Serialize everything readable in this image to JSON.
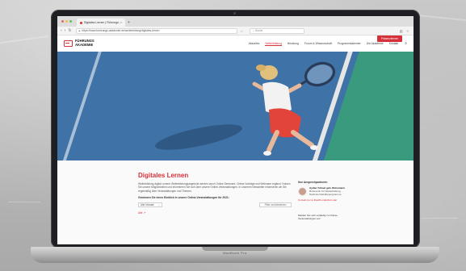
{
  "browser": {
    "tab_title": "Digitales Lernen | Führungs...",
    "tab_close": "×",
    "new_tab": "+",
    "url": "https://www.fuehrungs-akademie.de/weiterbildung/digitales-lernen",
    "search_placeholder": "Suche",
    "nav_back": "‹",
    "nav_forward": "›",
    "nav_reload": "↻"
  },
  "site": {
    "logo_line1": "FÜHRUNGS",
    "logo_line2": "AKADEMIE",
    "nav": [
      "Aktuelles",
      "Weiterbildung",
      "Beratung",
      "Forum & Wissenschaft",
      "Programmkalender",
      "Die Akademie",
      "Kontakt"
    ],
    "active_nav_index": 1,
    "cta": "Präsenzlernen"
  },
  "content": {
    "heading": "Digitales Lernen",
    "paragraph": "Weiterbildung digital: unsere Weiterbildungsangebote werden durch Online-Seminare, Online-Vorträge und Webinare ergänzt. Nutzen Sie unsere Möglichkeiten und informieren Sie sich über unsere Online-Veranstaltungen. In unserem Newsletter informieren wir Sie regelmäßig über Veranstaltungen und Themen.",
    "question": "Gewinnen Sie einen Einblick in unsere Online-Veranstaltungen für 2021:",
    "select_value": "Alle Monate",
    "select_right": "Filter zurücksetzen",
    "all_link": "Alle ↗"
  },
  "sidebar": {
    "heading": "Ihre Ansprechpartnerin",
    "contact_name": "Aydan Yüksel geb. Ruhemann",
    "contact_role": "Referentin für Weiterbildung, Nachwuchskräfteprogramme",
    "link_text": "Kontakt per E-Mail/Kontaktformular",
    "note": "Melden Sie sich vorläufig zu Online-Veranstaltungen an!"
  },
  "device": {
    "label": "MacBook Pro"
  },
  "colors": {
    "accent": "#d6303a",
    "court_blue": "#3f72a6",
    "court_green": "#3a9a7e"
  }
}
